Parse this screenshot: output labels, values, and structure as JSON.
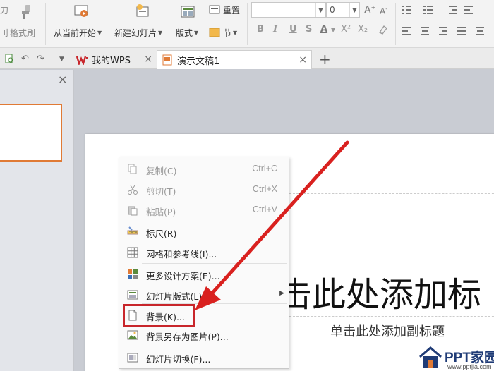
{
  "ribbon": {
    "format_painter": "格式刷",
    "from_current": "从当前开始",
    "new_slide": "新建幻灯片",
    "layout": "版式",
    "section": "节",
    "reset": "重置",
    "font_size": "0",
    "font_grow": "A",
    "font_shrink": "A",
    "bold": "B",
    "italic": "I",
    "underline": "U",
    "strike": "S",
    "font_color": "A",
    "superscript": "X²",
    "subscript": "X₂",
    "cut_partial": "刀",
    "partial_left": "刂"
  },
  "tabs": {
    "items": [
      {
        "label": "我的WPS"
      },
      {
        "label": "演示文稿1"
      }
    ],
    "add": "+",
    "close": "×"
  },
  "left_pane": {
    "close": "×"
  },
  "slide": {
    "title": "击此处添加标",
    "subtitle": "单击此处添加副标题"
  },
  "context_menu": {
    "items": [
      {
        "label": "复制(C)",
        "shortcut": "Ctrl+C",
        "icon": "copy-icon",
        "enabled": false
      },
      {
        "label": "剪切(T)",
        "shortcut": "Ctrl+X",
        "icon": "scissors-icon",
        "enabled": false
      },
      {
        "label": "粘贴(P)",
        "shortcut": "Ctrl+V",
        "icon": "paste-icon",
        "enabled": false
      },
      {
        "label": "标尺(R)",
        "shortcut": "",
        "icon": "ruler-icon",
        "enabled": true
      },
      {
        "label": "网格和参考线(I)...",
        "shortcut": "",
        "icon": "grid-icon",
        "enabled": true
      },
      {
        "label": "更多设计方案(E)...",
        "shortcut": "",
        "icon": "design-icon",
        "enabled": true
      },
      {
        "label": "幻灯片版式(L)",
        "shortcut": "",
        "icon": "layout-icon",
        "enabled": true
      },
      {
        "label": "背景(K)...",
        "shortcut": "",
        "icon": "background-icon",
        "enabled": true
      },
      {
        "label": "背景另存为图片(P)...",
        "shortcut": "",
        "icon": "save-image-icon",
        "enabled": true
      },
      {
        "label": "幻灯片切换(F)...",
        "shortcut": "",
        "icon": "transition-icon",
        "enabled": true
      }
    ]
  },
  "watermark": {
    "text": "PPT家园",
    "url": "www.pptjia.com"
  },
  "colors": {
    "accent_wps": "#c8262b",
    "annotation_red": "#d9211f",
    "thumb_border": "#e07a35"
  }
}
